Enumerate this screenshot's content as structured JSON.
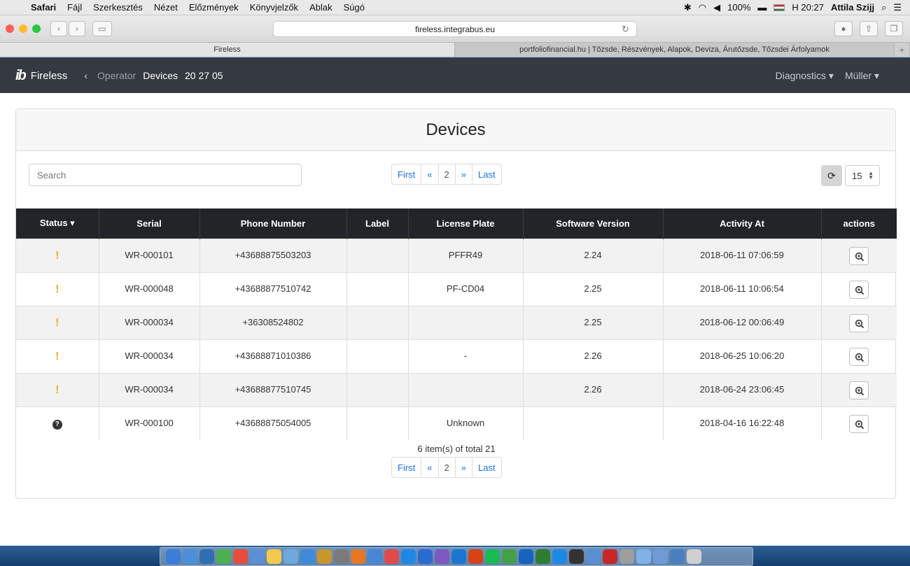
{
  "menubar": {
    "app": "Safari",
    "items": [
      "Fájl",
      "Szerkesztés",
      "Nézet",
      "Előzmények",
      "Könyvjelzők",
      "Ablak",
      "Súgó"
    ],
    "battery": "100%",
    "clock": "H 20:27",
    "user": "Attila Szijj"
  },
  "browser": {
    "url": "fireless.integrabus.eu",
    "tabs": [
      {
        "title": "Fireless",
        "active": true
      },
      {
        "title": "portfoliofinancial.hu | Tőzsde, Részvények, Alapok, Deviza, Árutőzsde, Tőzsdei Árfolyamok",
        "active": false
      }
    ]
  },
  "appnav": {
    "logo": "ib",
    "brand": "Fireless",
    "breadcrumb": [
      "Operator",
      "Devices",
      "20 27 05"
    ],
    "menus": [
      "Diagnostics ▾",
      "Müller ▾"
    ]
  },
  "page": {
    "title": "Devices",
    "search_placeholder": "Search",
    "pager": {
      "first": "First",
      "prev": "«",
      "current": "2",
      "next": "»",
      "last": "Last"
    },
    "per_page": "15",
    "summary": "6 item(s) of total 21"
  },
  "table": {
    "columns": [
      "Status ▾",
      "Serial",
      "Phone Number",
      "Label",
      "License Plate",
      "Software Version",
      "Activity At",
      "actions"
    ],
    "rows": [
      {
        "status": "warning",
        "serial": "WR-000101",
        "phone": "+43688875503203",
        "label": "",
        "plate": "PFFR49",
        "version": "2.24",
        "activity": "2018-06-11 07:06:59"
      },
      {
        "status": "warning",
        "serial": "WR-000048",
        "phone": "+43688877510742",
        "label": "",
        "plate": "PF-CD04",
        "version": "2.25",
        "activity": "2018-06-11 10:06:54"
      },
      {
        "status": "warning",
        "serial": "WR-000034",
        "phone": "+36308524802",
        "label": "",
        "plate": "",
        "version": "2.25",
        "activity": "2018-06-12 00:06:49"
      },
      {
        "status": "warning",
        "serial": "WR-000034",
        "phone": "+43688871010386",
        "label": "",
        "plate": "-",
        "version": "2.26",
        "activity": "2018-06-25 10:06:20"
      },
      {
        "status": "warning",
        "serial": "WR-000034",
        "phone": "+43688877510745",
        "label": "",
        "plate": "",
        "version": "2.26",
        "activity": "2018-06-24 23:06:45"
      },
      {
        "status": "unknown",
        "serial": "WR-000100",
        "phone": "+43688875054005",
        "label": "",
        "plate": "Unknown",
        "version": "",
        "activity": "2018-04-16 16:22:48"
      }
    ]
  },
  "colors": {
    "warning": "#f0ad1c",
    "navbar": "#343a40",
    "table_head": "#212529",
    "link": "#1a73e8"
  }
}
